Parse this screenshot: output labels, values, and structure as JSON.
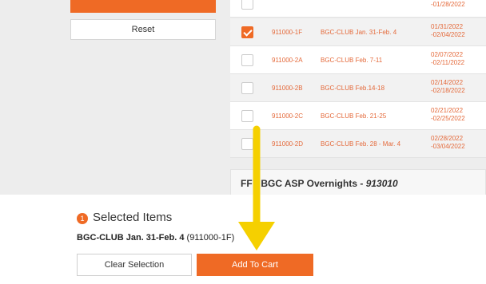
{
  "sidebar": {
    "reset_label": "Reset"
  },
  "sessions": [
    {
      "code": "",
      "name": "",
      "date_start": "",
      "date_end": "-01/28/2022",
      "checked": false
    },
    {
      "code": "911000-1F",
      "name": "BGC-CLUB Jan. 31-Feb. 4",
      "date_start": "01/31/2022",
      "date_end": "-02/04/2022",
      "checked": true
    },
    {
      "code": "911000-2A",
      "name": "BGC-CLUB Feb. 7-11",
      "date_start": "02/07/2022",
      "date_end": "-02/11/2022",
      "checked": false
    },
    {
      "code": "911000-2B",
      "name": "BGC-CLUB Feb.14-18",
      "date_start": "02/14/2022",
      "date_end": "-02/18/2022",
      "checked": false
    },
    {
      "code": "911000-2C",
      "name": "BGC-CLUB Feb. 21-25",
      "date_start": "02/21/2022",
      "date_end": "-02/25/2022",
      "checked": false
    },
    {
      "code": "911000-2D",
      "name": "BGC-CLUB Feb. 28 - Mar. 4",
      "date_start": "02/28/2022",
      "date_end": "-03/04/2022",
      "checked": false
    }
  ],
  "section": {
    "title": "FF - BGC ASP Overnights - ",
    "code": "913010"
  },
  "selected": {
    "count": "1",
    "title": "Selected Items",
    "item_name": "BGC-CLUB Jan. 31-Feb. 4",
    "item_code": " (911000-1F)",
    "clear_label": "Clear Selection",
    "cart_label": "Add To Cart"
  },
  "colors": {
    "accent": "#ef6a25",
    "annotation_arrow": "#f5d000",
    "link_text": "#e4693a"
  },
  "annotation": {
    "icon": "down-arrow-icon"
  }
}
